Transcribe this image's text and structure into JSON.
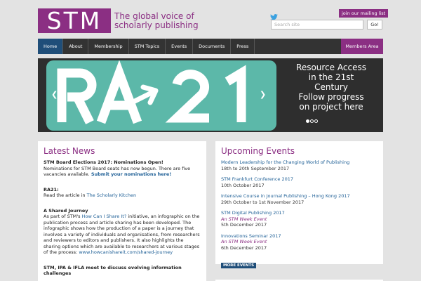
{
  "header": {
    "logo_text": "STM",
    "tagline_line1": "The global voice of",
    "tagline_line2": "scholarly publishing",
    "mailing_label": "join our mailing list",
    "search_placeholder": "Search site",
    "search_button": "Go!"
  },
  "nav": {
    "items": [
      "Home",
      "About",
      "Membership",
      "STM Topics",
      "Events",
      "Documents",
      "Press"
    ],
    "members": "Members Area"
  },
  "slider": {
    "image_text": "RA21",
    "caption_line1": "Resource Access",
    "caption_line2": "in the 21st",
    "caption_line3": "Century",
    "caption_line4": "Follow progress",
    "caption_line5": "on project here"
  },
  "news": {
    "title": "Latest News",
    "items": [
      {
        "title": "STM Board Elections 2017: Nominations Open!",
        "text": "Nominations for STM Board seats has now begun.  There are five vacancies available.",
        "link": "Submit your nominations here!"
      },
      {
        "title": "RA21:",
        "text": "Read the article in",
        "link": "The Scholarly Kitchen"
      },
      {
        "title": "A Shared Journey",
        "text_prefix": "As part of STM's",
        "link_inline": "How Can I Share It?",
        "text": "initiative, an infographic on the publication process and article sharing has been developed. The infographic shows how the production of a paper is a journey that involves a variety of individuals and organisations, from researchers and reviewers to editors and publishers. It also highlights the sharing options which are available to researchers at various stages of the process:",
        "link": "www.howcanishareit.com/shared-journey"
      },
      {
        "title": "STM, IPA & IFLA meet to discuss evolving information challenges"
      }
    ]
  },
  "events": {
    "title": "Upcoming Events",
    "items": [
      {
        "title": "Modern Leadership for the Changing World of Publishing",
        "sub": "",
        "date": "18th to 20th September 2017"
      },
      {
        "title": "STM Frankfurt Conference 2017",
        "sub": "",
        "date": "10th October 2017"
      },
      {
        "title": "Intensive Course in Journal Publishing – Hong Kong 2017",
        "sub": "",
        "date": "29th October to 1st November 2017"
      },
      {
        "title": "STM Digital Publishing 2017",
        "sub": "An STM Week Event",
        "date": "5th December 2017"
      },
      {
        "title": "Innovations Seminar 2017",
        "sub": "An STM Week Event",
        "date": "6th December 2017"
      }
    ],
    "more": "MORE EVENTS"
  },
  "colors": {
    "brand": "#8b2f83",
    "nav": "#333333",
    "nav_active": "#1f4e79",
    "link": "#1e5f96",
    "slide_bg": "#5cb8a9"
  },
  "icons": [
    "twitter-icon",
    "prev-arrow-icon",
    "next-arrow-icon"
  ]
}
